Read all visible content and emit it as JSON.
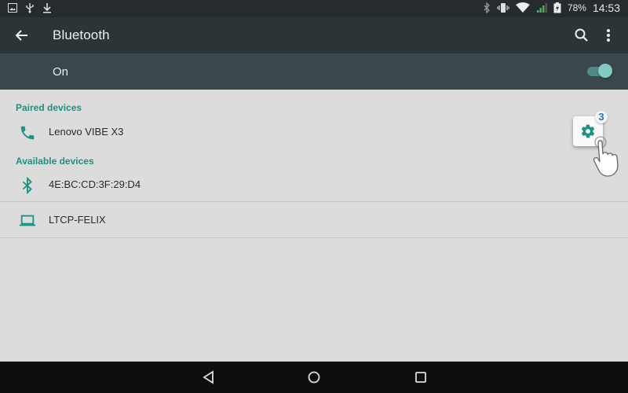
{
  "status_bar": {
    "left_icons": [
      "image-icon",
      "usb-icon",
      "download-icon"
    ],
    "right_icons": [
      "bluetooth-icon",
      "vibrate-icon",
      "wifi-icon",
      "signal-icon",
      "battery-charging-icon"
    ],
    "battery": "78%",
    "time": "14:53"
  },
  "toolbar": {
    "title": "Bluetooth",
    "back_icon": "arrow-back-icon",
    "search_icon": "search-icon",
    "more_icon": "more-vert-icon"
  },
  "master_switch": {
    "label": "On",
    "checked": true
  },
  "sections": {
    "paired": {
      "header": "Paired devices",
      "devices": [
        {
          "name": "Lenovo VIBE X3",
          "icon": "phone-icon"
        }
      ]
    },
    "available": {
      "header": "Available devices",
      "devices": [
        {
          "name": "4E:BC:CD:3F:29:D4",
          "icon": "bluetooth-icon"
        },
        {
          "name": "LTCP-FELIX",
          "icon": "laptop-icon"
        }
      ]
    }
  },
  "annotation": {
    "step_number": "3",
    "target": "settings-gear-button"
  },
  "colors": {
    "accent": "#1d9183",
    "toolbar": "#2d3437",
    "switch_bar": "#3a474c",
    "background": "#dcdcdc",
    "badge_text": "#1a7ac4"
  },
  "nav_bar": {
    "buttons": [
      "back",
      "home",
      "recents"
    ]
  }
}
